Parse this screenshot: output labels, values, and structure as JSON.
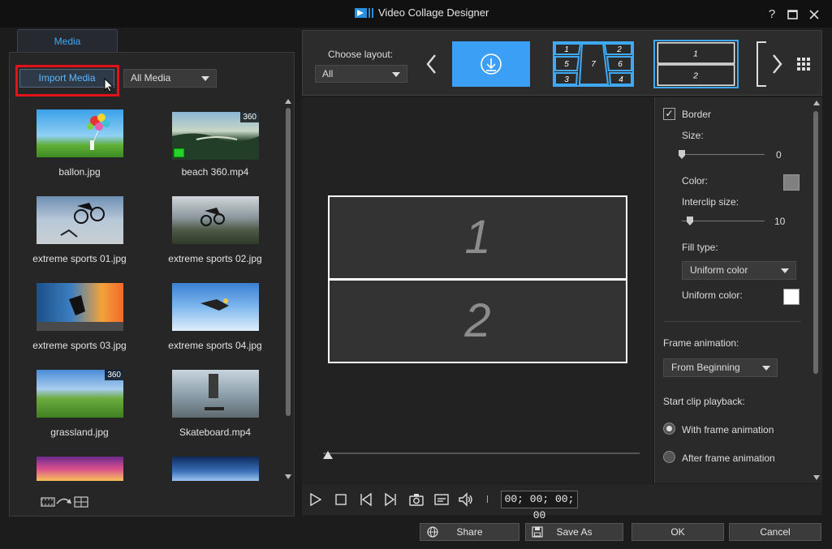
{
  "window": {
    "title": "Video Collage Designer",
    "help_label": "?"
  },
  "media_panel": {
    "tab_label": "Media",
    "import_button": "Import Media",
    "filter_value": "All Media",
    "items": [
      {
        "label": "ballon.jpg",
        "badge": ""
      },
      {
        "label": "beach 360.mp4",
        "badge": "360"
      },
      {
        "label": "extreme sports 01.jpg",
        "badge": ""
      },
      {
        "label": "extreme sports 02.jpg",
        "badge": ""
      },
      {
        "label": "extreme sports 03.jpg",
        "badge": ""
      },
      {
        "label": "extreme sports 04.jpg",
        "badge": ""
      },
      {
        "label": "grassland.jpg",
        "badge": "360"
      },
      {
        "label": "Skateboard.mp4",
        "badge": ""
      }
    ]
  },
  "layout_strip": {
    "choose_label": "Choose layout:",
    "select_value": "All",
    "grid_numbers": [
      "1",
      "2",
      "5",
      "7",
      "6",
      "3",
      "4"
    ],
    "two_numbers": [
      "1",
      "2"
    ]
  },
  "preview": {
    "cell_1": "1",
    "cell_2": "2",
    "timecode": "00; 00; 00; 00"
  },
  "settings": {
    "border_label": "Border",
    "border_checked": true,
    "size_label": "Size:",
    "size_value": "0",
    "color_label": "Color:",
    "color_value": "#808080",
    "interclip_label": "Interclip size:",
    "interclip_value": "10",
    "fill_type_label": "Fill type:",
    "fill_type_value": "Uniform color",
    "uniform_color_label": "Uniform color:",
    "uniform_color_value": "#ffffff",
    "frame_animation_label": "Frame animation:",
    "frame_animation_value": "From Beginning",
    "start_clip_label": "Start clip playback:",
    "radio_with": "With frame animation",
    "radio_after": "After frame animation",
    "selected_radio": "With frame animation"
  },
  "footer": {
    "share": "Share",
    "save_as": "Save As",
    "ok": "OK",
    "cancel": "Cancel"
  },
  "colors": {
    "accent": "#3fa9f5",
    "highlight_red": "#e0131a"
  }
}
